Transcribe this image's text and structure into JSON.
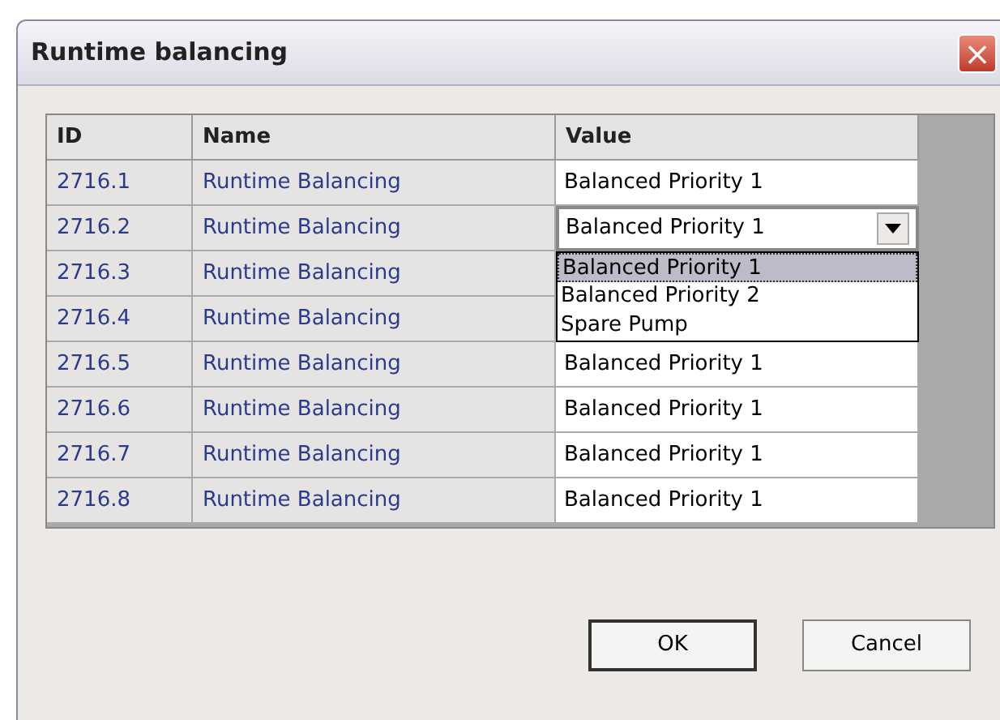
{
  "window": {
    "title": "Runtime balancing",
    "close_glyph": "×"
  },
  "table": {
    "columns": [
      "ID",
      "Name",
      "Value"
    ],
    "rows": [
      {
        "id": "2716.1",
        "name": "Runtime Balancing",
        "value": "Balanced Priority 1",
        "kind": "text"
      },
      {
        "id": "2716.2",
        "name": "Runtime Balancing",
        "value": "Balanced Priority 1",
        "kind": "combo"
      },
      {
        "id": "2716.3",
        "name": "Runtime Balancing",
        "kind": "hidden"
      },
      {
        "id": "2716.4",
        "name": "Runtime Balancing",
        "kind": "hidden"
      },
      {
        "id": "2716.5",
        "name": "Runtime Balancing",
        "value": "Balanced Priority 1",
        "kind": "text"
      },
      {
        "id": "2716.6",
        "name": "Runtime Balancing",
        "value": "Balanced Priority 1",
        "kind": "text"
      },
      {
        "id": "2716.7",
        "name": "Runtime Balancing",
        "value": "Balanced Priority 1",
        "kind": "text"
      },
      {
        "id": "2716.8",
        "name": "Runtime Balancing",
        "value": "Balanced Priority 1",
        "kind": "text"
      }
    ]
  },
  "dropdown": {
    "options": [
      {
        "label": "Balanced Priority 1",
        "selected": true
      },
      {
        "label": "Balanced Priority 2",
        "selected": false
      },
      {
        "label": "Spare Pump",
        "selected": false
      }
    ]
  },
  "buttons": [
    "OK",
    "Cancel"
  ]
}
